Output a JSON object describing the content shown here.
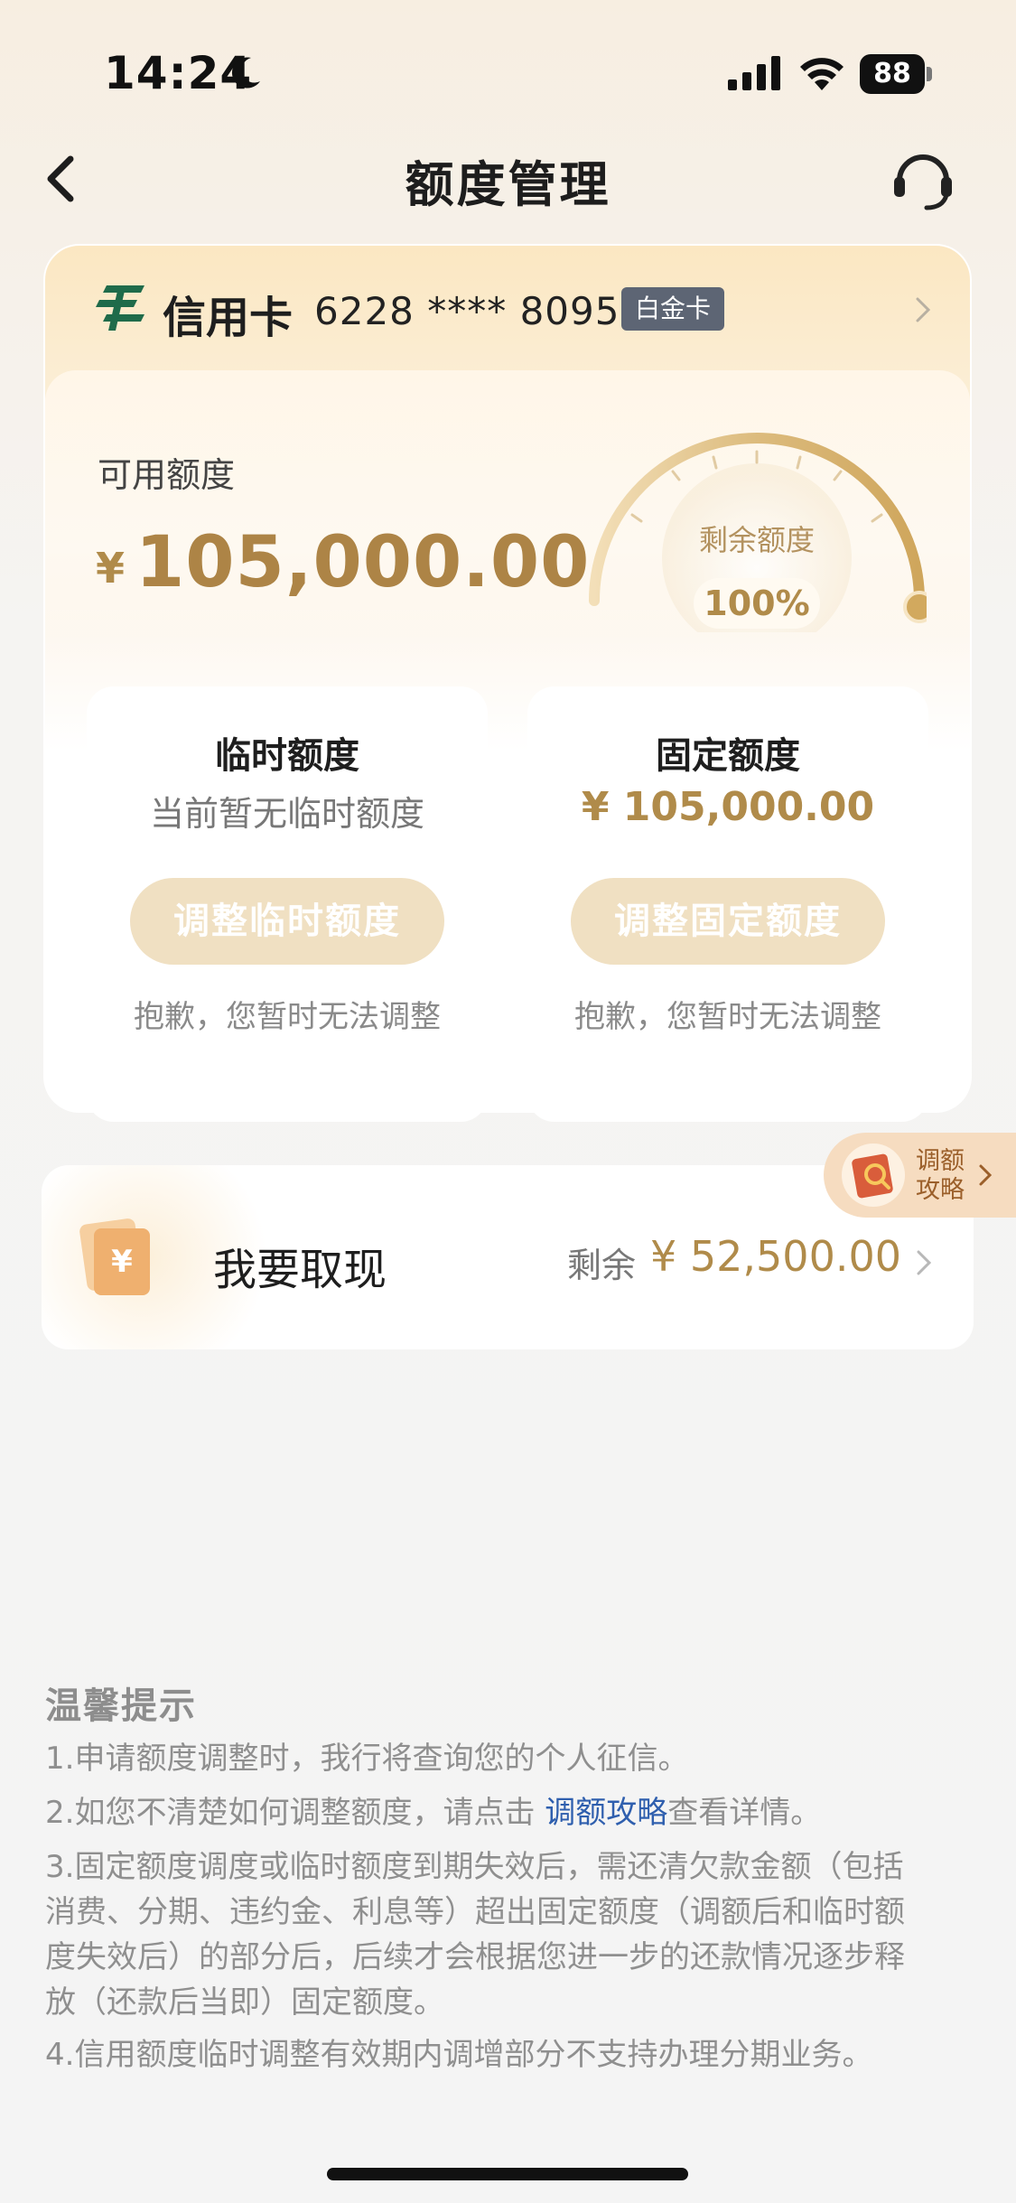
{
  "status_bar": {
    "time": "14:24",
    "battery": "88"
  },
  "nav": {
    "title": "额度管理"
  },
  "card": {
    "name": "信用卡",
    "number": "6228 **** 8095",
    "badge": "白金卡"
  },
  "available": {
    "label": "可用额度",
    "currency": "¥",
    "amount": "105,000.00"
  },
  "gauge": {
    "label": "剩余额度",
    "percent_text": "100%",
    "percent_value": 100
  },
  "temporary": {
    "title": "临时额度",
    "desc": "当前暂无临时额度",
    "button": "调整临时额度",
    "note": "抱歉，您暂时无法调整"
  },
  "fixed": {
    "title": "固定额度",
    "amount": "¥ 105,000.00",
    "button": "调整固定额度",
    "note": "抱歉，您暂时无法调整"
  },
  "guide": {
    "line1": "调额",
    "line2": "攻略"
  },
  "withdraw": {
    "label": "我要取现",
    "remaining_label": "剩余",
    "remaining_amount": "¥ 52,500.00"
  },
  "tips": {
    "title": "温馨提示",
    "item1": "1.申请额度调整时，我行将查询您的个人征信。",
    "item2_before": "2.如您不清楚如何调整额度，请点击 ",
    "item2_link": "调额攻略",
    "item2_after": "查看详情。",
    "item3_line1": "3.固定额度调度或临时额度到期失效后，需还清欠款金额（包括",
    "item3_line2": "消费、分期、违约金、利息等）超出固定额度（调额后和临时额",
    "item3_line3": "度失效后）的部分后，后续才会根据您进一步的还款情况逐步释",
    "item3_line4": "放（还款后当即）固定额度。",
    "item4": "4.信用额度临时调整有效期内调增部分不支持办理分期业务。"
  },
  "colors": {
    "gold": "#b08b4a",
    "button_bg": "#f0e0c2",
    "link": "#2f5fae"
  }
}
